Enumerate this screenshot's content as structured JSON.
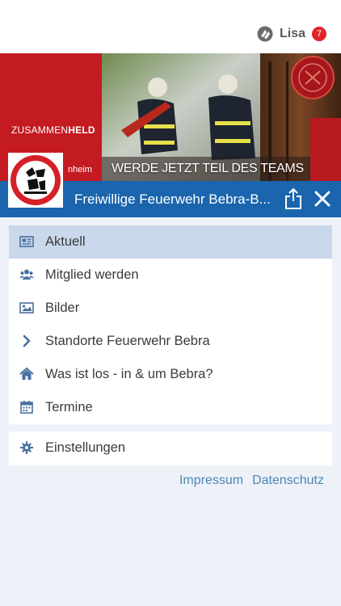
{
  "header": {
    "user_name": "Lisa",
    "notification_count": "7",
    "icon": "app-logo-icon"
  },
  "banner": {
    "brand_light": "ZUSAMMEN",
    "brand_bold": "HELD",
    "location_fragment": "nheim",
    "slogan": "WERDE JETZT TEIL DES TEAMS",
    "accent_color": "#c41a22"
  },
  "titlebar": {
    "title": "Freiwillige Feuerwehr Bebra-B...",
    "color": "#1a65ad"
  },
  "menu": {
    "items": [
      {
        "label": "Aktuell",
        "icon": "newspaper-icon",
        "active": true
      },
      {
        "label": "Mitglied werden",
        "icon": "users-icon",
        "active": false
      },
      {
        "label": "Bilder",
        "icon": "image-icon",
        "active": false
      },
      {
        "label": "Standorte Feuerwehr Bebra",
        "icon": "chevron-right-icon",
        "active": false
      },
      {
        "label": "Was ist los - in & um Bebra?",
        "icon": "home-icon",
        "active": false
      },
      {
        "label": "Termine",
        "icon": "calendar-icon",
        "active": false
      }
    ],
    "settings": {
      "label": "Einstellungen",
      "icon": "gear-icon"
    }
  },
  "footer": {
    "impressum": "Impressum",
    "datenschutz": "Datenschutz"
  }
}
